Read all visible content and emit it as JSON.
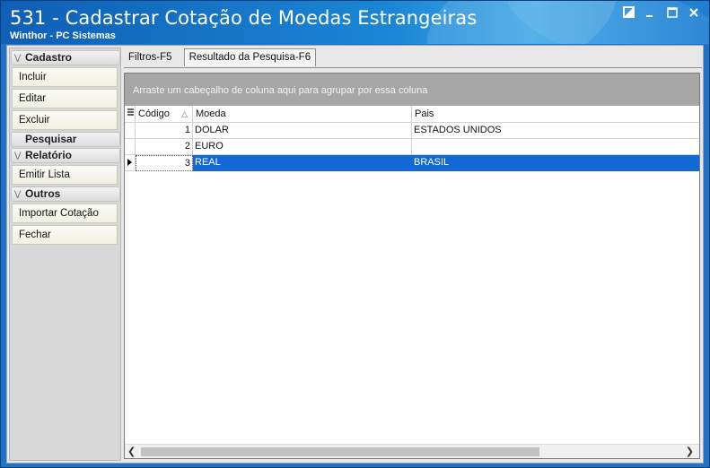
{
  "window": {
    "title": "531 - Cadastrar Cotação de Moedas Estrangeiras",
    "subtitle": "Winthor - PC Sistemas"
  },
  "sidebar": {
    "groups": [
      {
        "label": "Cadastro",
        "items": [
          "Incluir",
          "Editar",
          "Excluir"
        ]
      },
      {
        "label": "Pesquisar",
        "items": []
      },
      {
        "label": "Relatório",
        "items": [
          "Emitir Lista"
        ]
      },
      {
        "label": "Outros",
        "items": [
          "Importar Cotação",
          "Fechar"
        ]
      }
    ]
  },
  "tabs": [
    {
      "label": "Filtros-F5",
      "active": false
    },
    {
      "label": "Resultado da Pesquisa-F6",
      "active": true
    }
  ],
  "grid": {
    "group_panel_text": "Arraste um cabeçalho de coluna aqui para agrupar por essa coluna",
    "columns": [
      "Código",
      "Moeda",
      "Pais"
    ],
    "rows": [
      {
        "codigo": "1",
        "moeda": "DOLAR",
        "pais": "ESTADOS UNIDOS"
      },
      {
        "codigo": "2",
        "moeda": "EURO",
        "pais": ""
      },
      {
        "codigo": "3",
        "moeda": "REAL",
        "pais": "BRASIL"
      }
    ],
    "selected_row": 3
  },
  "colors": {
    "titlebar": "#1b86d6",
    "selection": "#1268d4",
    "group_panel": "#a6a6a6"
  },
  "icons": {
    "restore": "restore-icon",
    "minimize": "minimize-icon",
    "maximize": "maximize-icon",
    "close": "close-icon"
  }
}
